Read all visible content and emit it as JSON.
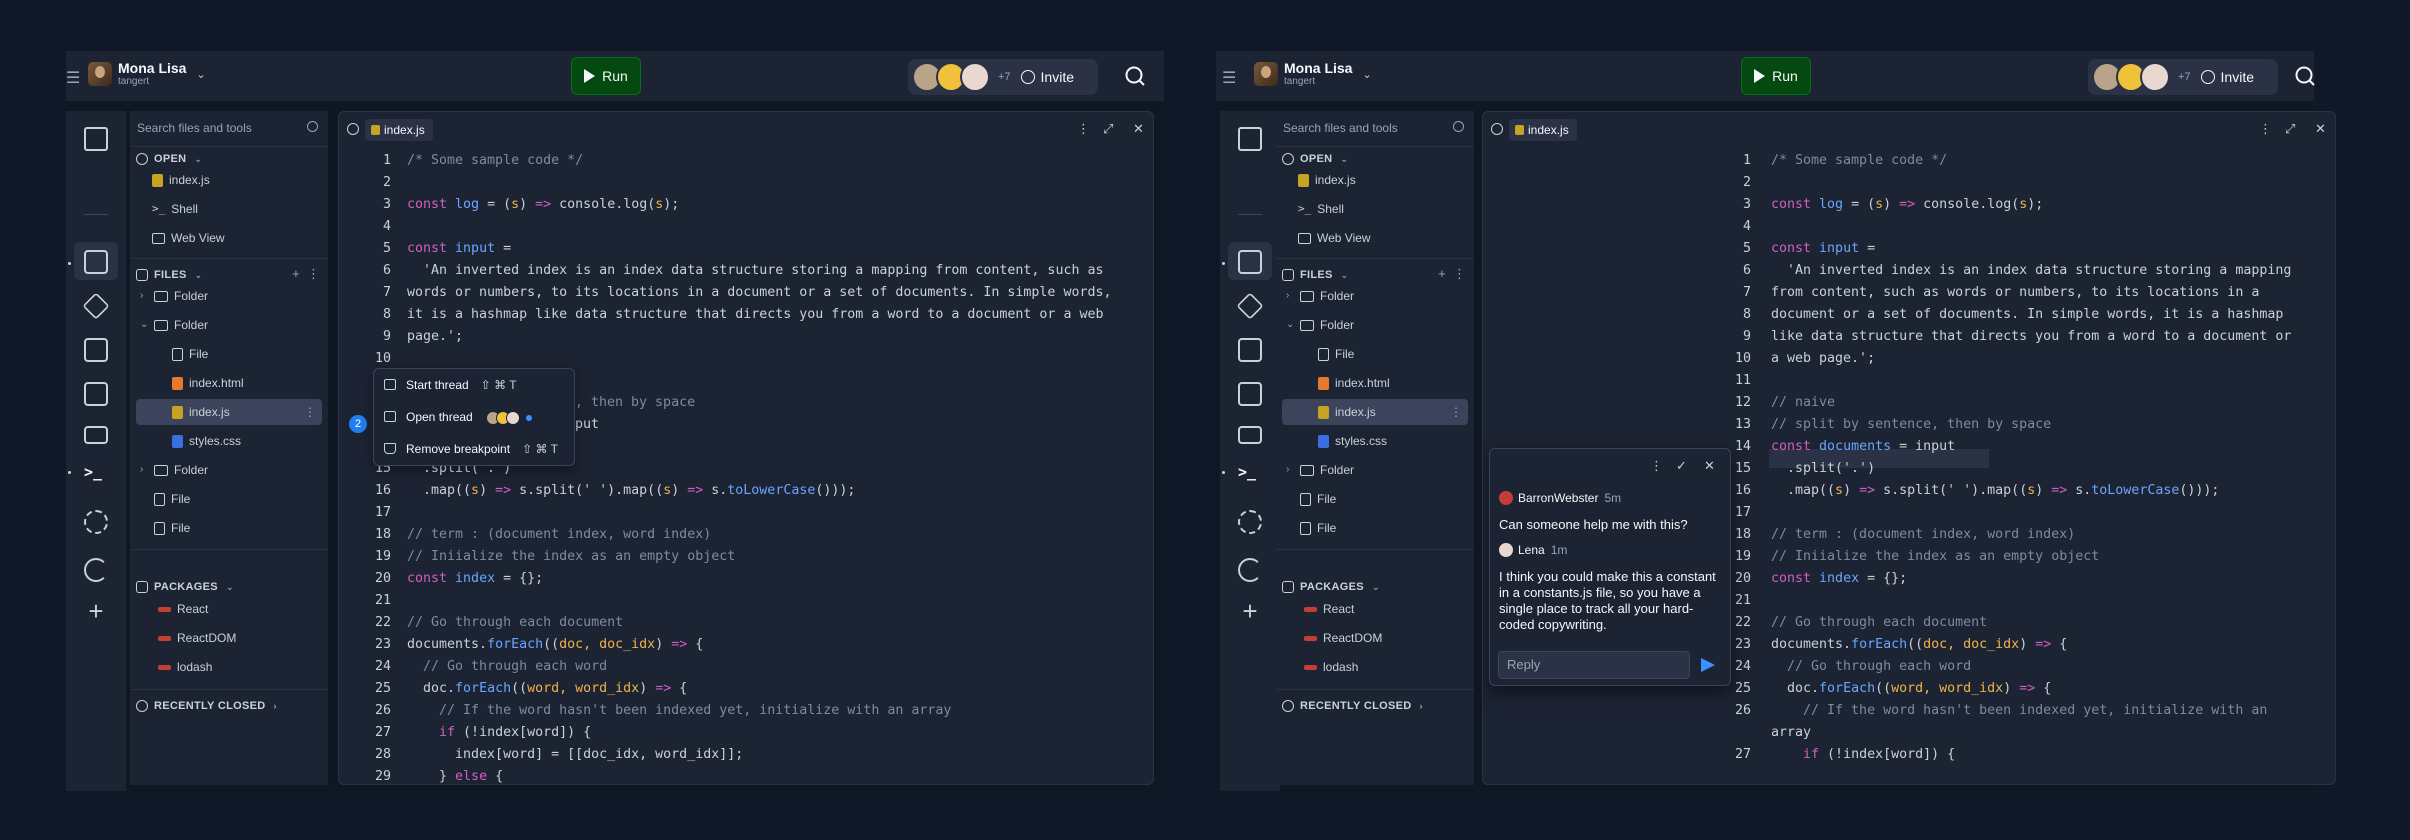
{
  "header": {
    "user_name": "Mona Lisa",
    "user_sub": "tangert",
    "run_label": "Run",
    "collab_more": "+7",
    "invite_label": "Invite"
  },
  "sidebar": {
    "search_placeholder": "Search files and tools",
    "open_label": "OPEN",
    "open_items": [
      {
        "label": "index.js",
        "icon": "js-file-icon"
      },
      {
        "label": "Shell",
        "icon": "shell-icon"
      },
      {
        "label": "Web View",
        "icon": "webview-icon"
      }
    ],
    "files_label": "FILES",
    "files": [
      {
        "label": "Folder",
        "type": "folder",
        "expanded": false
      },
      {
        "label": "Folder",
        "type": "folder",
        "expanded": true
      },
      {
        "label": "File",
        "type": "file"
      },
      {
        "label": "index.html",
        "type": "html"
      },
      {
        "label": "index.js",
        "type": "js",
        "selected": true
      },
      {
        "label": "styles.css",
        "type": "css"
      },
      {
        "label": "Folder",
        "type": "folder",
        "expanded": false
      },
      {
        "label": "File",
        "type": "file"
      },
      {
        "label": "File",
        "type": "file"
      }
    ],
    "packages_label": "PACKAGES",
    "packages": [
      "React",
      "ReactDOM",
      "lodash"
    ],
    "recently_closed_label": "RECENTLY CLOSED"
  },
  "editor": {
    "tab_label": "index.js",
    "left_lines": [
      "/* Some sample code */",
      "",
      "const log = (s) => console.log(s);",
      "",
      "const input =",
      "  'An inverted index is an index data structure storing a mapping from content, such as",
      "words or numbers, to its locations in a document or a set of documents. In simple words,",
      "it is a hashmap like data structure that directs you from a word to a document or a web",
      "page.';",
      "",
      "",
      "// naive",
      "// split by sentence, then by space",
      "const documents = input",
      "  .split('.')",
      "  .map((s) => s.split(' ').map((s) => s.toLowerCase()));",
      "",
      "// term : (document index, word index)",
      "// Iniialize the index as an empty object",
      "const index = {};",
      "",
      "// Go through each document",
      "documents.forEach((doc, doc_idx) => {",
      "  // Go through each word",
      "  doc.forEach((word, word_idx) => {",
      "    // If the word hasn't been indexed yet, initialize with an array",
      "    if (!index[word]) {",
      "      index[word] = [[doc_idx, word_idx]];",
      "    } else {"
    ],
    "right_lines": [
      "/* Some sample code */",
      "",
      "const log = (s) => console.log(s);",
      "",
      "const input =",
      "  'An inverted index is an index data structure storing a mapping",
      "from content, such as words or numbers, to its locations in a",
      "document or a set of documents. In simple words, it is a hashmap",
      "like data structure that directs you from a word to a document or",
      "a web page.';",
      "",
      "// naive",
      "// split by sentence, then by space",
      "const documents = input",
      "  .split('.')",
      "  .map((s) => s.split(' ').map((s) => s.toLowerCase()));",
      "",
      "// term : (document index, word index)",
      "// Iniialize the index as an empty object",
      "const index = {};",
      "",
      "// Go through each document",
      "documents.forEach((doc, doc_idx) => {",
      "  // Go through each word",
      "  doc.forEach((word, word_idx) => {",
      "    // If the word hasn't been indexed yet, initialize with an",
      "array",
      "    if (!index[word]) {"
    ],
    "right_line_numbers": [
      "1",
      "2",
      "3",
      "4",
      "5",
      "6",
      "7",
      "8",
      "9",
      "10",
      "11",
      "12",
      "13",
      "14",
      "15",
      "16",
      "17",
      "18",
      "19",
      "20",
      "21",
      "22",
      "23",
      "24",
      "25",
      "26",
      "",
      "27"
    ]
  },
  "context_menu": {
    "badge": "2",
    "items": [
      {
        "label": "Start thread",
        "shortcut": "⇧ ⌘ T"
      },
      {
        "label": "Open thread",
        "shortcut": ""
      },
      {
        "label": "Remove breakpoint",
        "shortcut": "⇧ ⌘ T"
      }
    ],
    "peek_line_11": "t then by space",
    "peek_line_12": "put"
  },
  "thread": {
    "comment1_user": "BarronWebster",
    "comment1_time": "5m",
    "comment1_text": "Can someone help me with this?",
    "comment2_user": "Lena",
    "comment2_time": "1m",
    "comment2_text": "I think you could make this a constant in a constants.js file, so you have a single place to track all your hard-coded copywriting.",
    "reply_placeholder": "Reply"
  }
}
